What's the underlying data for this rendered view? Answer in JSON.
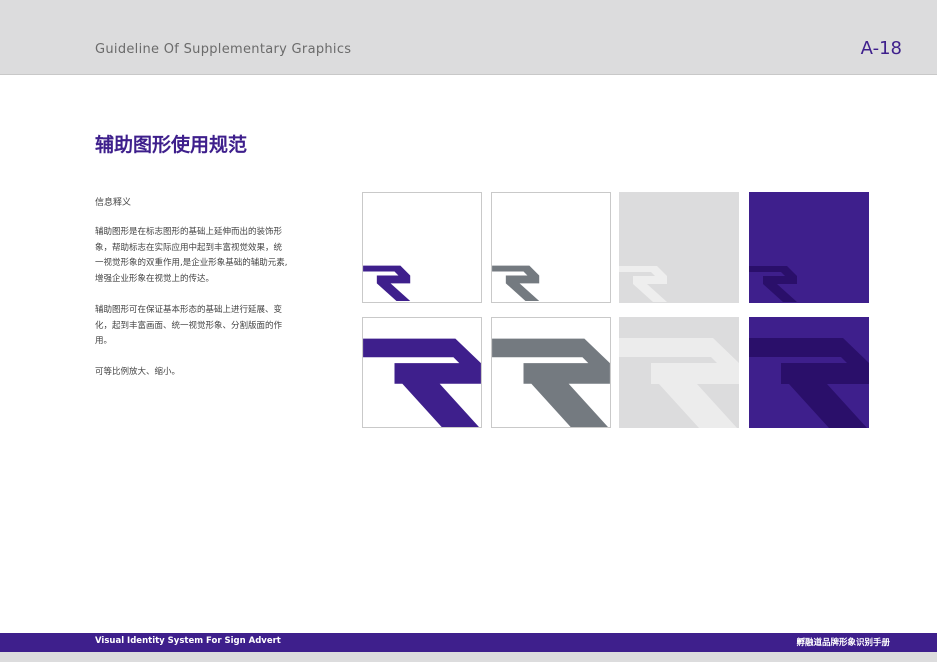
{
  "header": {
    "title": "Guideline Of Supplementary Graphics",
    "page_number": "A-18"
  },
  "page_heading": "辅助图形使用规范",
  "info": {
    "label": "信息释义",
    "paragraph_1": "辅助图形是在标志图形的基础上延伸而出的装饰形象，帮助标志在实际应用中起到丰富视觉效果，统一视觉形象的双重作用,是企业形象基础的辅助元素,增强企业形象在视觉上的传达。",
    "paragraph_2": "辅助图形可在保证基本形态的基础上进行延展、变化，起到丰富画面、统一视觉形象、分割版面的作用。",
    "paragraph_3": "可等比例放大、缩小。"
  },
  "colors": {
    "brand_purple": "#3e1f8c",
    "dark_purple": "#2a0f6a",
    "gray": "#747a80",
    "light_gray": "#dcdcdd",
    "white": "#ffffff"
  },
  "footer": {
    "left": "Visual Identity System For Sign Advert",
    "right": "孵融道品牌形象识别手册"
  }
}
